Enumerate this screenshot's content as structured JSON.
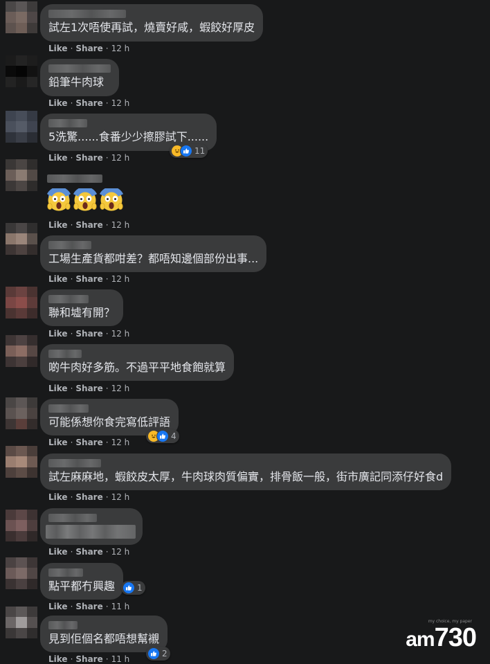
{
  "actions": {
    "like": "Like",
    "share": "Share"
  },
  "watermark": {
    "am": "am",
    "num": "730",
    "tag": "my choice, my paper"
  },
  "colors": {
    "background": "#18191a",
    "bubble": "#3a3b3c",
    "like_blue": "#1877f2",
    "haha_yellow": "#f7b928",
    "meta_text": "#b0b3b8"
  },
  "comments": [
    {
      "text": "試左1次唔使再試，燒賣好咸，蝦餃好厚皮",
      "time": "12 h"
    },
    {
      "text": "鉛筆牛肉球",
      "time": "12 h"
    },
    {
      "text": "5洗驚......食番少少擦膠試下......",
      "time": "12 h",
      "reactions": {
        "icons": [
          "haha-icon",
          "like-icon"
        ],
        "count": "11"
      }
    },
    {
      "emojis": [
        "😱",
        "😱",
        "😱"
      ],
      "time": "12 h"
    },
    {
      "text": "工場生產貨都咁差？都唔知邊個部份出事...",
      "time": "12 h"
    },
    {
      "text": "聯和墟有開？",
      "time": "12 h"
    },
    {
      "text": "啲牛肉好多筋。不過平平地食飽就算",
      "time": "12 h"
    },
    {
      "text": "可能係想你食完寫低評語",
      "time": "12 h",
      "reactions": {
        "icons": [
          "haha-icon",
          "like-icon"
        ],
        "count": "4"
      }
    },
    {
      "text": "試左麻麻地，蝦餃皮太厚，牛肉球肉質偏實，排骨飯一般，街市廣記同添仔好食d",
      "time": "12 h"
    },
    {
      "text": "",
      "time": "12 h"
    },
    {
      "text": "點平都冇興趣",
      "time": "11 h",
      "reactions": {
        "icons": [
          "like-icon"
        ],
        "count": "1"
      }
    },
    {
      "text": "見到佢個名都唔想幫襯",
      "time": "11 h",
      "reactions": {
        "icons": [
          "like-icon"
        ],
        "count": "2"
      }
    }
  ]
}
